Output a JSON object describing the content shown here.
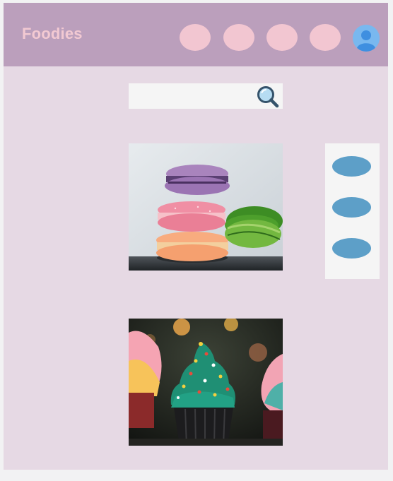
{
  "app": {
    "brand": "Foodies"
  },
  "header": {
    "nav_items": [
      "nav-item-1",
      "nav-item-2",
      "nav-item-3",
      "nav-item-4"
    ],
    "avatar_icon": "user-avatar-icon"
  },
  "search": {
    "value": "",
    "placeholder": "",
    "icon": "magnifier-icon"
  },
  "photos": [
    {
      "subject": "macarons"
    },
    {
      "subject": "cupcakes"
    }
  ],
  "side_panel": {
    "buttons": 3
  },
  "colors": {
    "background": "#e6d9e4",
    "header": "#bb9fbc",
    "brand_text": "#f2c9d2",
    "nav_pill": "#f2c6d1",
    "avatar": "#79b8ef",
    "side_button": "#5d9fc8"
  }
}
